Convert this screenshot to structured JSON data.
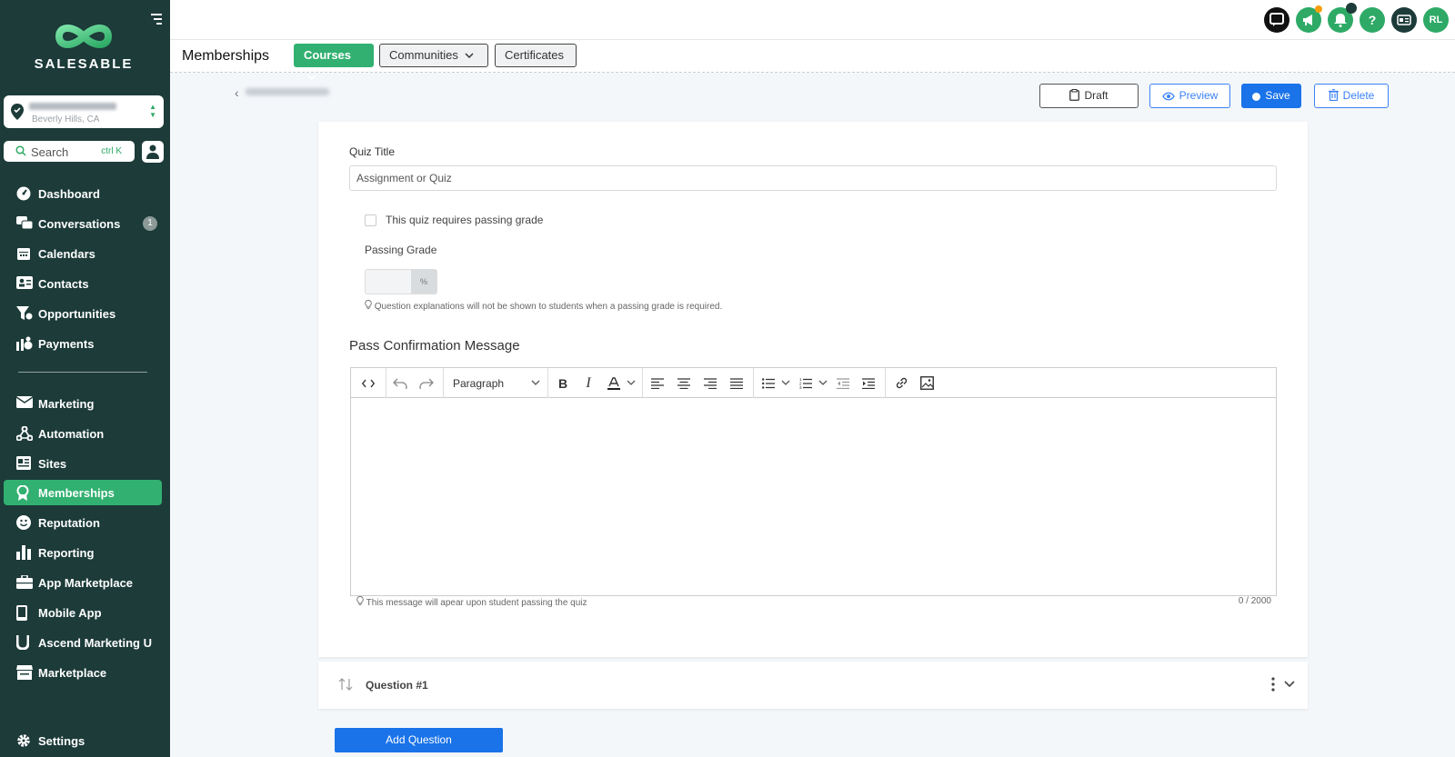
{
  "sidebar": {
    "logo_text": "SALESABLE",
    "location_city": "Beverly Hills, CA",
    "search_label": "Search",
    "search_shortcut": "ctrl K",
    "items": [
      {
        "label": "Dashboard",
        "icon": "dashboard-icon"
      },
      {
        "label": "Conversations",
        "icon": "chat-icon",
        "badge": "1"
      },
      {
        "label": "Calendars",
        "icon": "calendar-icon"
      },
      {
        "label": "Contacts",
        "icon": "contacts-icon"
      },
      {
        "label": "Opportunities",
        "icon": "funnel-icon"
      },
      {
        "label": "Payments",
        "icon": "payments-icon"
      },
      {
        "label": "Marketing",
        "icon": "mail-icon"
      },
      {
        "label": "Automation",
        "icon": "automation-icon"
      },
      {
        "label": "Sites",
        "icon": "sites-icon"
      },
      {
        "label": "Memberships",
        "icon": "award-icon",
        "active": true
      },
      {
        "label": "Reputation",
        "icon": "smile-icon"
      },
      {
        "label": "Reporting",
        "icon": "bar-chart-icon"
      },
      {
        "label": "App Marketplace",
        "icon": "briefcase-icon"
      },
      {
        "label": "Mobile App",
        "icon": "mobile-icon"
      },
      {
        "label": "Ascend Marketing U",
        "icon": "u-icon"
      },
      {
        "label": "Marketplace",
        "icon": "store-icon"
      }
    ],
    "settings_label": "Settings"
  },
  "topbar": {
    "avatar_initials": "RL"
  },
  "nav": {
    "title": "Memberships",
    "courses": "Courses",
    "communities": "Communities",
    "certificates": "Certificates"
  },
  "actions": {
    "draft": "Draft",
    "preview": "Preview",
    "save": "Save",
    "delete": "Delete"
  },
  "quiz": {
    "title_label": "Quiz Title",
    "title_value": "Assignment or Quiz",
    "passing_checkbox_label": "This quiz requires passing grade",
    "passing_grade_label": "Passing Grade",
    "percent_symbol": "%",
    "passing_hint": "Question explanations will not be shown to students when a passing grade is required.",
    "pass_confirmation_title": "Pass Confirmation Message",
    "editor_block_format": "Paragraph",
    "message_hint": "This message will apear upon student passing the quiz",
    "char_counter": "0 / 2000"
  },
  "questions": [
    {
      "title": "Question #1"
    }
  ],
  "add_question_label": "Add Question",
  "colors": {
    "sidebar_bg": "#1c3b39",
    "accent_green": "#32b071",
    "primary_blue": "#1a73e8"
  }
}
